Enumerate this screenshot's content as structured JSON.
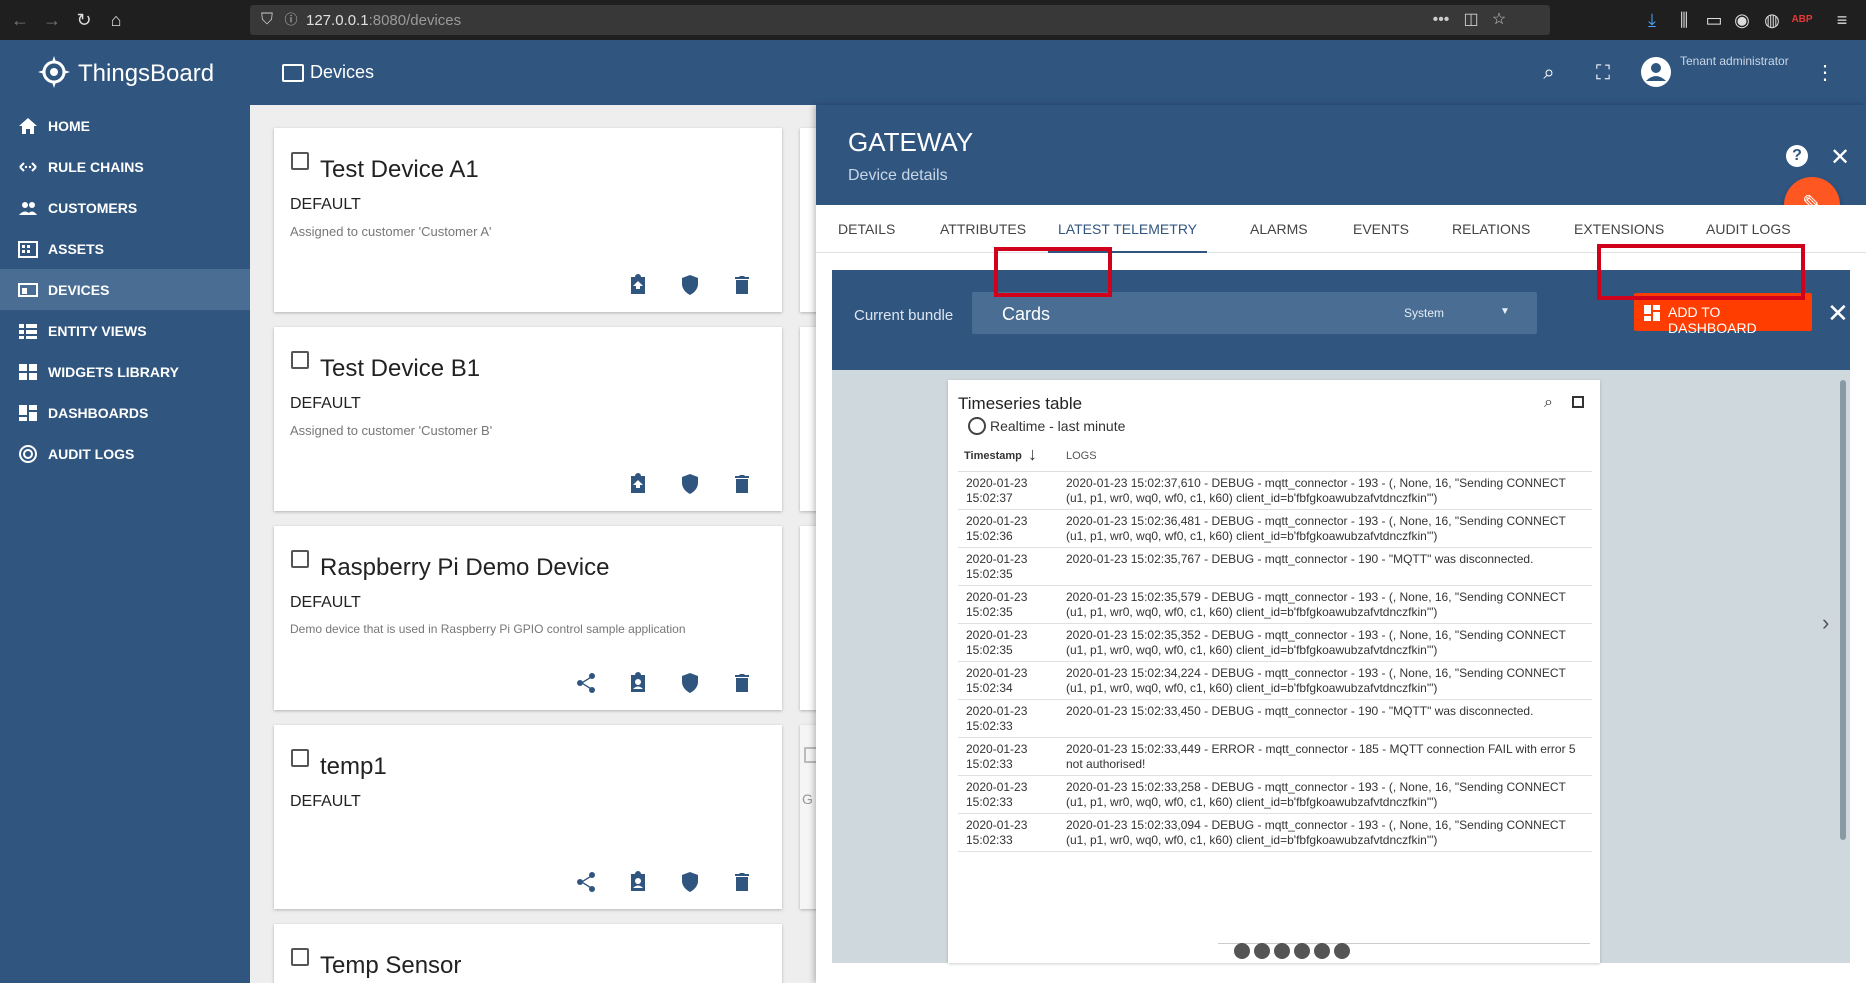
{
  "browser": {
    "url_host": "127.0.0.1",
    "url_path": ":8080/devices"
  },
  "app": {
    "brand": "ThingsBoard",
    "page_title": "Devices",
    "user_role": "Tenant administrator"
  },
  "sidebar": {
    "items": [
      {
        "label": "HOME",
        "icon": "home-icon"
      },
      {
        "label": "RULE CHAINS",
        "icon": "rule-chain-icon"
      },
      {
        "label": "CUSTOMERS",
        "icon": "customers-icon"
      },
      {
        "label": "ASSETS",
        "icon": "assets-icon"
      },
      {
        "label": "DEVICES",
        "icon": "devices-icon"
      },
      {
        "label": "ENTITY VIEWS",
        "icon": "entity-views-icon"
      },
      {
        "label": "WIDGETS LIBRARY",
        "icon": "widgets-icon"
      },
      {
        "label": "DASHBOARDS",
        "icon": "dashboards-icon"
      },
      {
        "label": "AUDIT LOGS",
        "icon": "audit-icon"
      }
    ],
    "active_index": 4
  },
  "devices": [
    {
      "name": "Test Device A1",
      "type": "DEFAULT",
      "desc": "Assigned to customer 'Customer A'"
    },
    {
      "name": "Test Device B1",
      "type": "DEFAULT",
      "desc": "Assigned to customer 'Customer B'"
    },
    {
      "name": "Raspberry Pi Demo Device",
      "type": "DEFAULT",
      "desc": "Demo device that is used in Raspberry Pi GPIO control sample application"
    },
    {
      "name": "temp1",
      "type": "DEFAULT",
      "desc": ""
    },
    {
      "name": "Temp Sensor",
      "type": "",
      "desc": ""
    }
  ],
  "partial_card_text": "G",
  "details": {
    "title": "GATEWAY",
    "subtitle": "Device details",
    "help": "?",
    "tabs": [
      "DETAILS",
      "ATTRIBUTES",
      "LATEST TELEMETRY",
      "ALARMS",
      "EVENTS",
      "RELATIONS",
      "EXTENSIONS",
      "AUDIT LOGS"
    ],
    "active_tab": 2
  },
  "bundle": {
    "label": "Current bundle",
    "value": "Cards",
    "scope": "System",
    "add_button": "ADD TO DASHBOARD"
  },
  "widget": {
    "title": "Timeseries table",
    "timewindow": "Realtime - last minute",
    "col_timestamp": "Timestamp",
    "col_logs": "LOGS",
    "rows": [
      {
        "ts1": "2020-01-23",
        "ts2": "15:02:37",
        "log": "2020-01-23 15:02:37,610 - DEBUG - mqtt_connector - 193 - (, None, 16, \"Sending CONNECT (u1, p1, wr0, wq0, wf0, c1, k60) client_id=b'fbfgkoawubzafvtdnczfkin'\")"
      },
      {
        "ts1": "2020-01-23",
        "ts2": "15:02:36",
        "log": "2020-01-23 15:02:36,481 - DEBUG - mqtt_connector - 193 - (, None, 16, \"Sending CONNECT (u1, p1, wr0, wq0, wf0, c1, k60) client_id=b'fbfgkoawubzafvtdnczfkin'\")"
      },
      {
        "ts1": "2020-01-23",
        "ts2": "15:02:35",
        "log": "2020-01-23 15:02:35,767 - DEBUG - mqtt_connector - 190 - \"MQTT\" was disconnected."
      },
      {
        "ts1": "2020-01-23",
        "ts2": "15:02:35",
        "log": "2020-01-23 15:02:35,579 - DEBUG - mqtt_connector - 193 - (, None, 16, \"Sending CONNECT (u1, p1, wr0, wq0, wf0, c1, k60) client_id=b'fbfgkoawubzafvtdnczfkin'\")"
      },
      {
        "ts1": "2020-01-23",
        "ts2": "15:02:35",
        "log": "2020-01-23 15:02:35,352 - DEBUG - mqtt_connector - 193 - (, None, 16, \"Sending CONNECT (u1, p1, wr0, wq0, wf0, c1, k60) client_id=b'fbfgkoawubzafvtdnczfkin'\")"
      },
      {
        "ts1": "2020-01-23",
        "ts2": "15:02:34",
        "log": "2020-01-23 15:02:34,224 - DEBUG - mqtt_connector - 193 - (, None, 16, \"Sending CONNECT (u1, p1, wr0, wq0, wf0, c1, k60) client_id=b'fbfgkoawubzafvtdnczfkin'\")"
      },
      {
        "ts1": "2020-01-23",
        "ts2": "15:02:33",
        "log": "2020-01-23 15:02:33,450 - DEBUG - mqtt_connector - 190 - \"MQTT\" was disconnected."
      },
      {
        "ts1": "2020-01-23",
        "ts2": "15:02:33",
        "log": "2020-01-23 15:02:33,449 - ERROR - mqtt_connector - 185 - MQTT connection FAIL with error 5 not authorised!"
      },
      {
        "ts1": "2020-01-23",
        "ts2": "15:02:33",
        "log": "2020-01-23 15:02:33,258 - DEBUG - mqtt_connector - 193 - (, None, 16, \"Sending CONNECT (u1, p1, wr0, wq0, wf0, c1, k60) client_id=b'fbfgkoawubzafvtdnczfkin'\")"
      },
      {
        "ts1": "2020-01-23",
        "ts2": "15:02:33",
        "log": "2020-01-23 15:02:33,094 - DEBUG - mqtt_connector - 193 - (, None, 16, \"Sending CONNECT (u1, p1, wr0, wq0, wf0, c1, k60) client_id=b'fbfgkoawubzafvtdnczfkin'\")"
      }
    ]
  },
  "colors": {
    "primary": "#305680",
    "accent": "#ff5722",
    "add_button": "#ff3d00",
    "highlight_box": "#d0021b"
  }
}
